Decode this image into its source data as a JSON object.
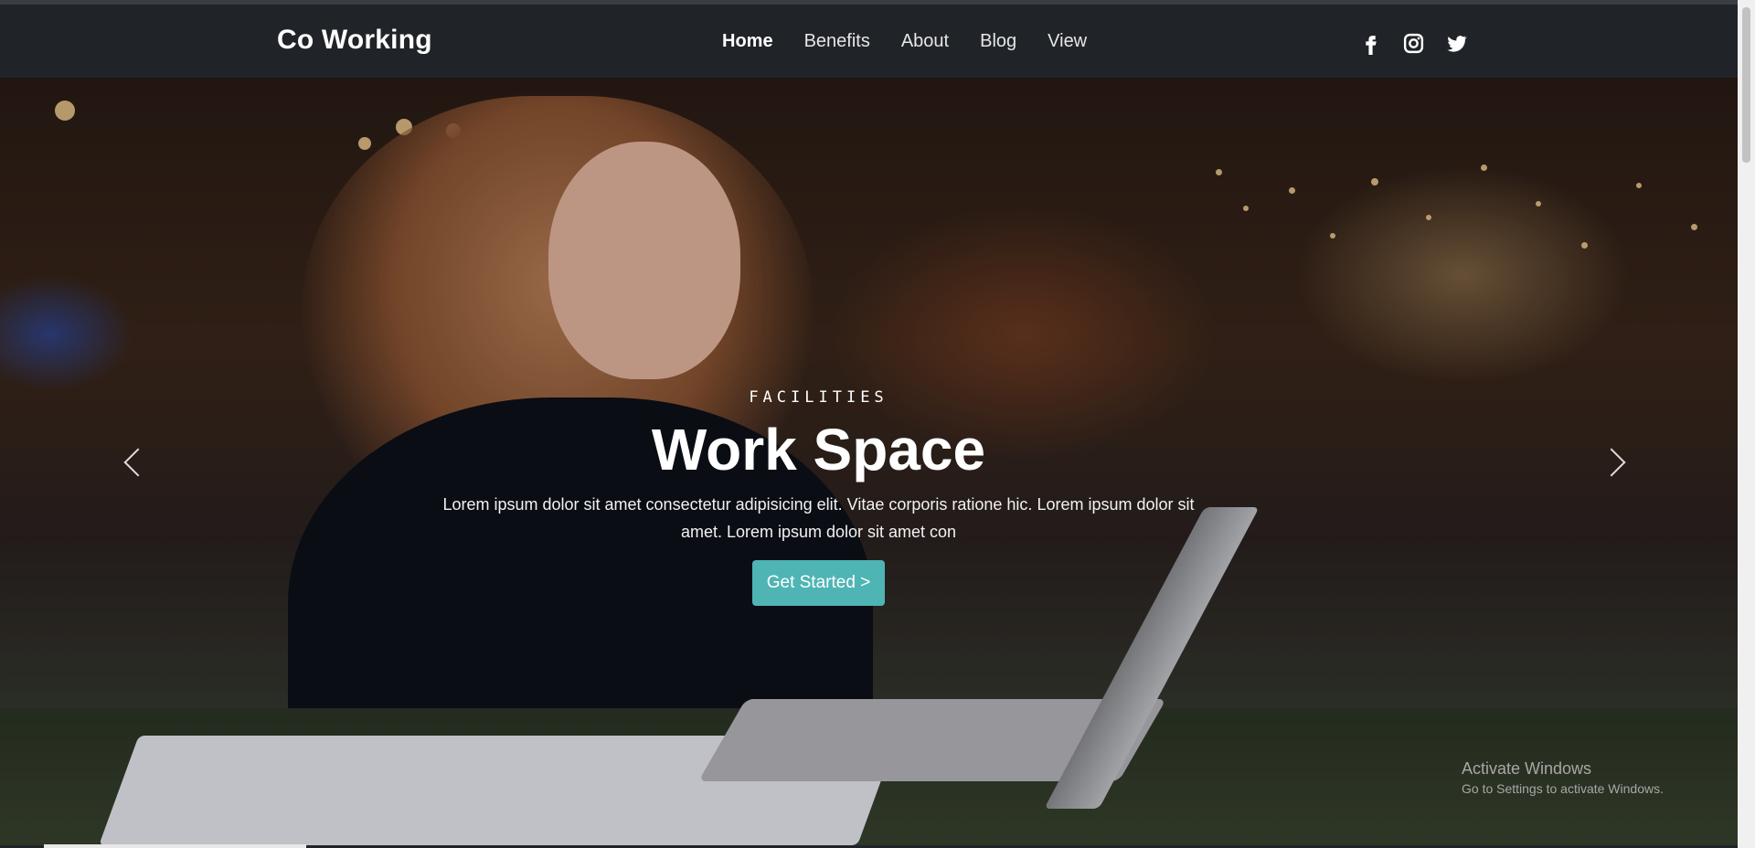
{
  "nav": {
    "brand": "Co Working",
    "links": [
      "Home",
      "Benefits",
      "About",
      "Blog",
      "View"
    ],
    "active": "Home",
    "social_icons": [
      "facebook-icon",
      "instagram-icon",
      "twitter-icon"
    ]
  },
  "hero": {
    "eyebrow": "FACILITIES",
    "title": "Work Space",
    "description": "Lorem ipsum dolor sit amet consectetur adipisicing elit. Vitae corporis ratione hic. Lorem ipsum dolor sit amet. Lorem ipsum dolor sit amet con",
    "button": "Get Started >",
    "accent_color": "#4fb4b4",
    "prev_icon": "chevron-left-icon",
    "next_icon": "chevron-right-icon"
  },
  "watermark": {
    "line1": "Activate Windows",
    "line2": "Go to Settings to activate Windows."
  }
}
